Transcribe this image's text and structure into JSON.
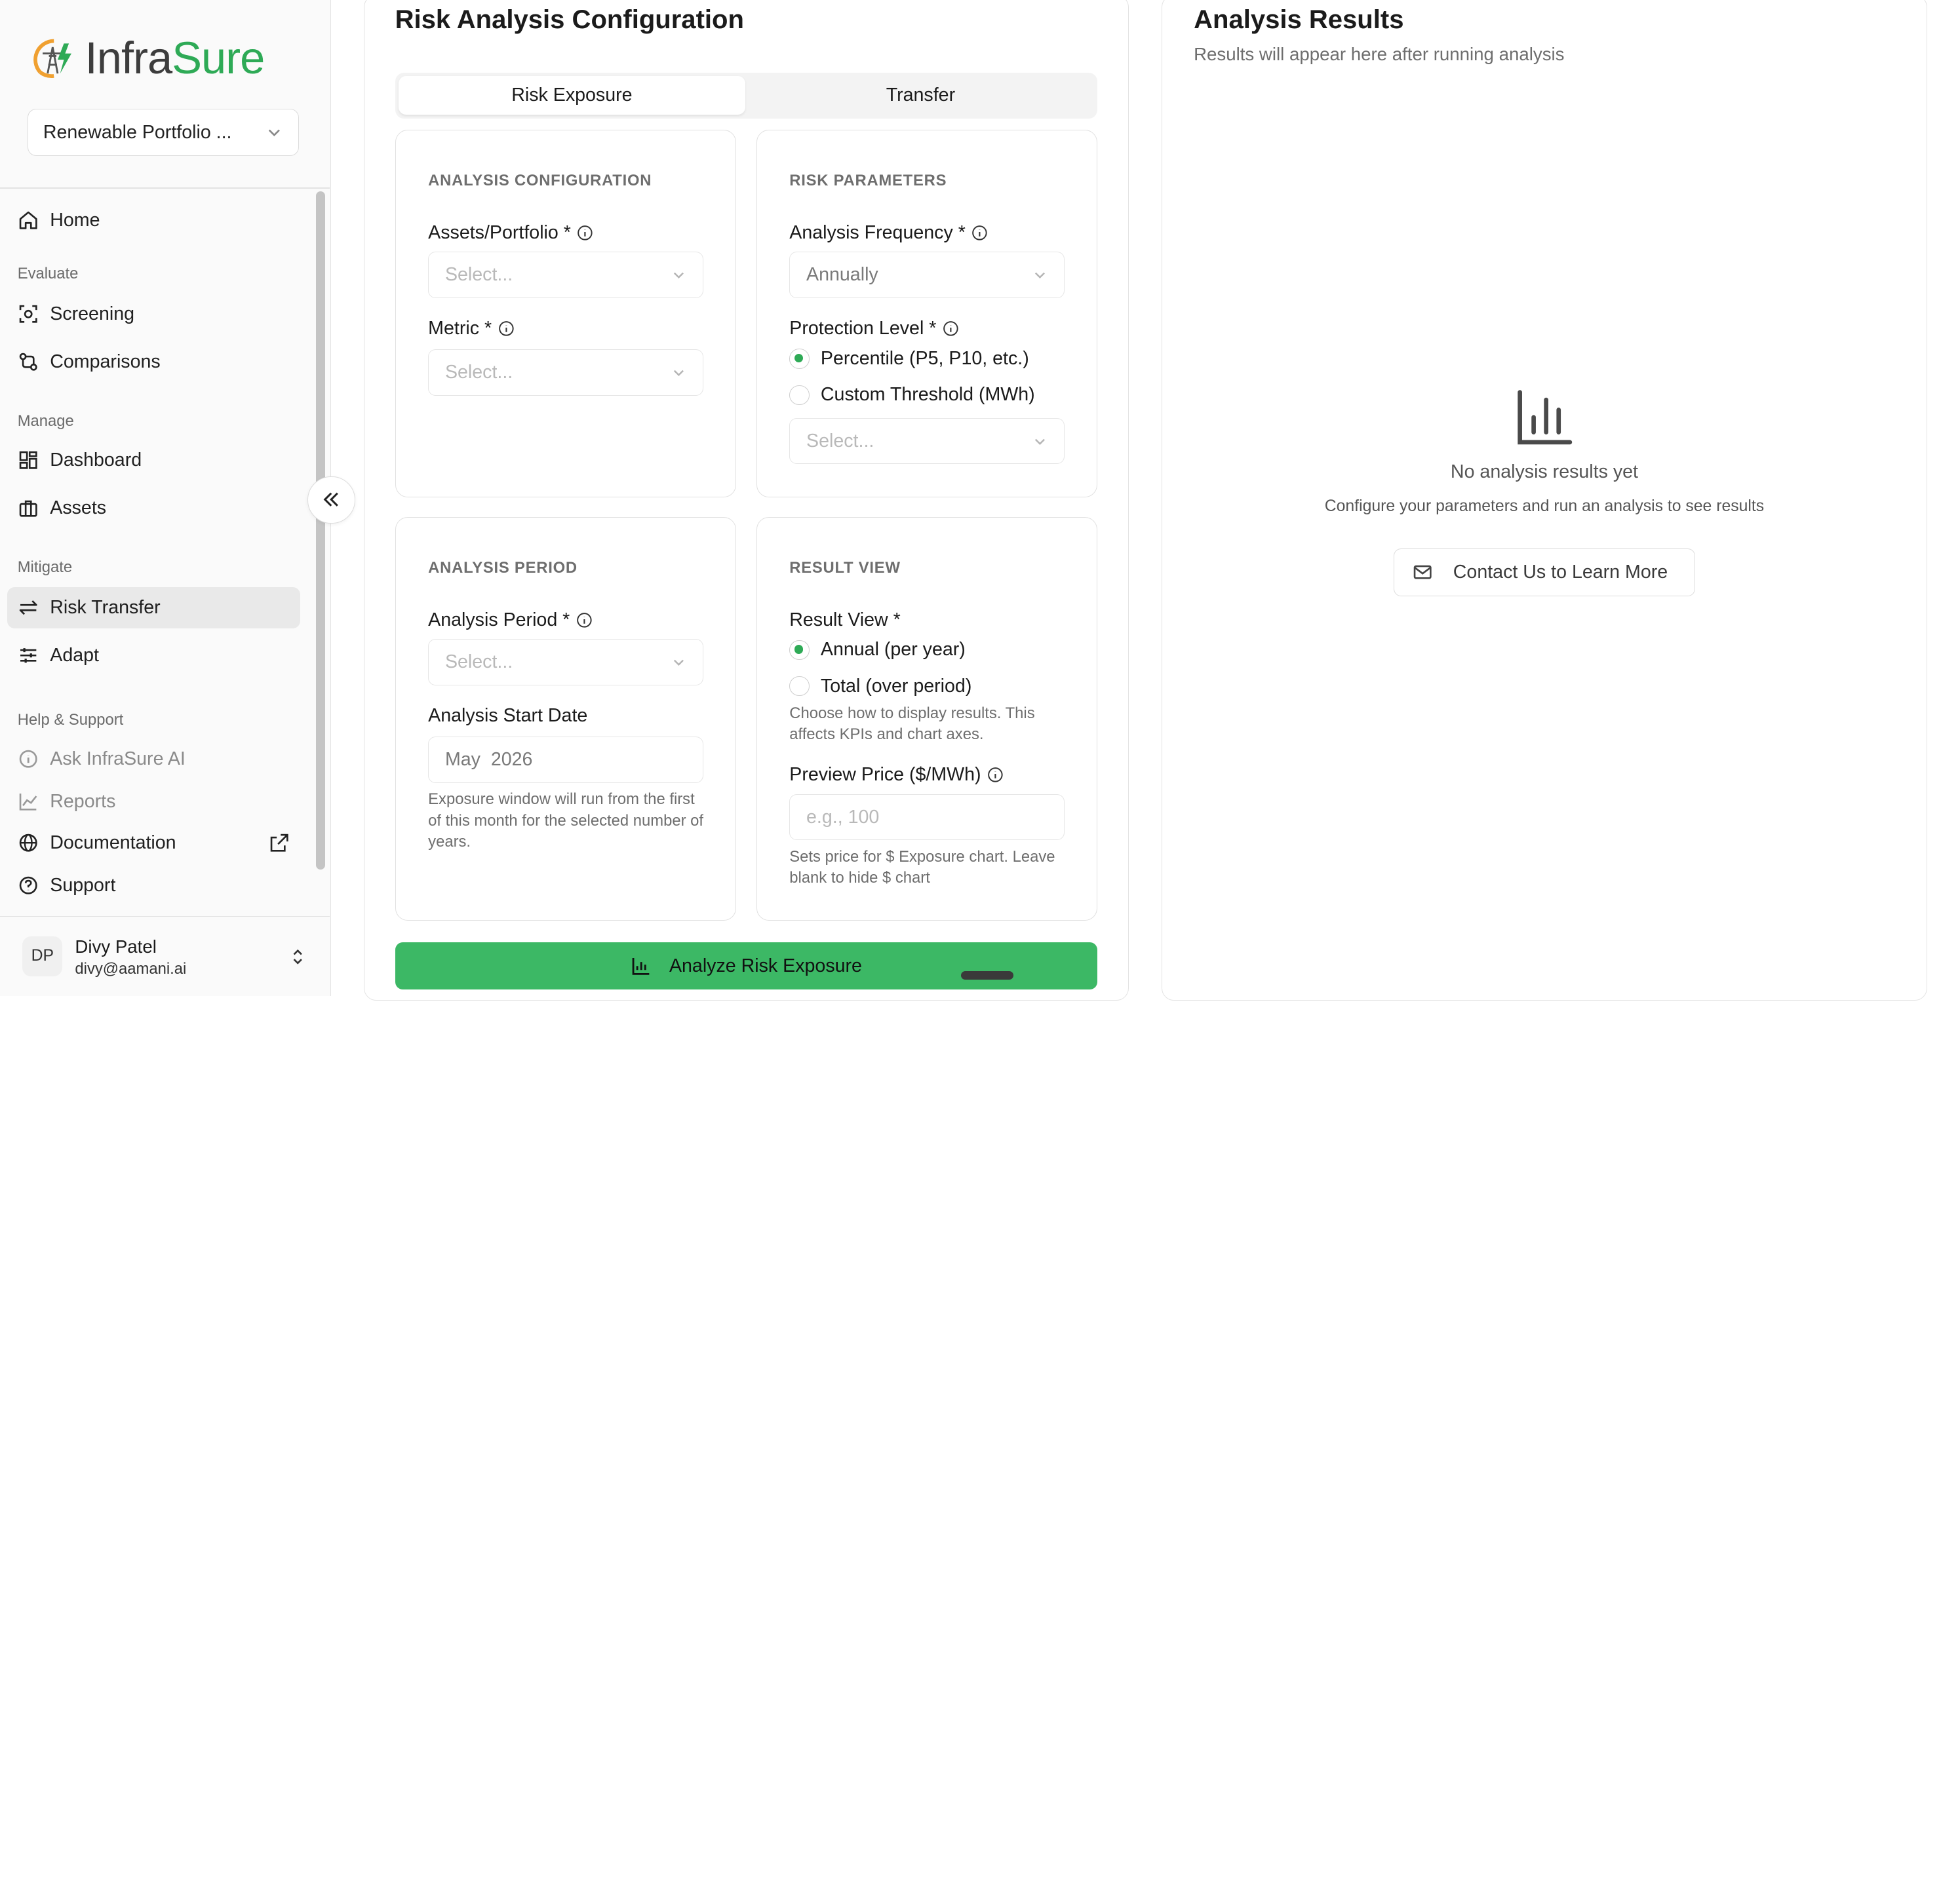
{
  "brand": {
    "name_part1": "Infra",
    "name_part2": "Sure",
    "accent": "#2eaa56"
  },
  "portfolio_selector": {
    "value": "Renewable Portfolio ..."
  },
  "sidebar": {
    "home": "Home",
    "groups": {
      "evaluate": "Evaluate",
      "manage": "Manage",
      "mitigate": "Mitigate",
      "help": "Help & Support"
    },
    "items": {
      "screening": "Screening",
      "comparisons": "Comparisons",
      "dashboard": "Dashboard",
      "assets": "Assets",
      "risk_transfer": "Risk Transfer",
      "adapt": "Adapt",
      "ask_ai": "Ask InfraSure AI",
      "reports": "Reports",
      "documentation": "Documentation",
      "support": "Support"
    },
    "active_item": "Risk Transfer"
  },
  "user": {
    "initials": "DP",
    "name": "Divy Patel",
    "email": "divy@aamani.ai"
  },
  "config": {
    "title": "Risk Analysis Configuration",
    "tabs": [
      "Risk Exposure",
      "Transfer"
    ],
    "active_tab": "Risk Exposure",
    "analysis_configuration": {
      "heading": "ANALYSIS CONFIGURATION",
      "assets_label": "Assets/Portfolio *",
      "assets_placeholder": "Select...",
      "metric_label": "Metric *",
      "metric_placeholder": "Select..."
    },
    "risk_parameters": {
      "heading": "RISK PARAMETERS",
      "frequency_label": "Analysis Frequency *",
      "frequency_value": "Annually",
      "protection_label": "Protection Level *",
      "protection_options": [
        "Percentile (P5, P10, etc.)",
        "Custom Threshold (MWh)"
      ],
      "protection_selected": "Percentile (P5, P10, etc.)",
      "protection_placeholder": "Select..."
    },
    "analysis_period": {
      "heading": "ANALYSIS PERIOD",
      "period_label": "Analysis Period *",
      "period_placeholder": "Select...",
      "start_label": "Analysis Start Date",
      "start_value": "May  2026",
      "help": "Exposure window will run from the first of this month for the selected number of years."
    },
    "result_view": {
      "heading": "RESULT VIEW",
      "label": "Result View *",
      "options": [
        "Annual (per year)",
        "Total (over period)"
      ],
      "selected": "Annual (per year)",
      "help": "Choose how to display results. This affects KPIs and chart axes.",
      "price_label": "Preview Price ($/MWh)",
      "price_placeholder": "e.g., 100",
      "price_help": "Sets price for $ Exposure chart. Leave blank to hide $ chart"
    },
    "analyze_button": "Analyze Risk Exposure"
  },
  "results": {
    "title": "Analysis Results",
    "subtitle": "Results will appear here after running analysis",
    "empty_title": "No analysis results yet",
    "empty_sub": "Configure your parameters and run an analysis to see results",
    "contact_button": "Contact Us to Learn More"
  }
}
